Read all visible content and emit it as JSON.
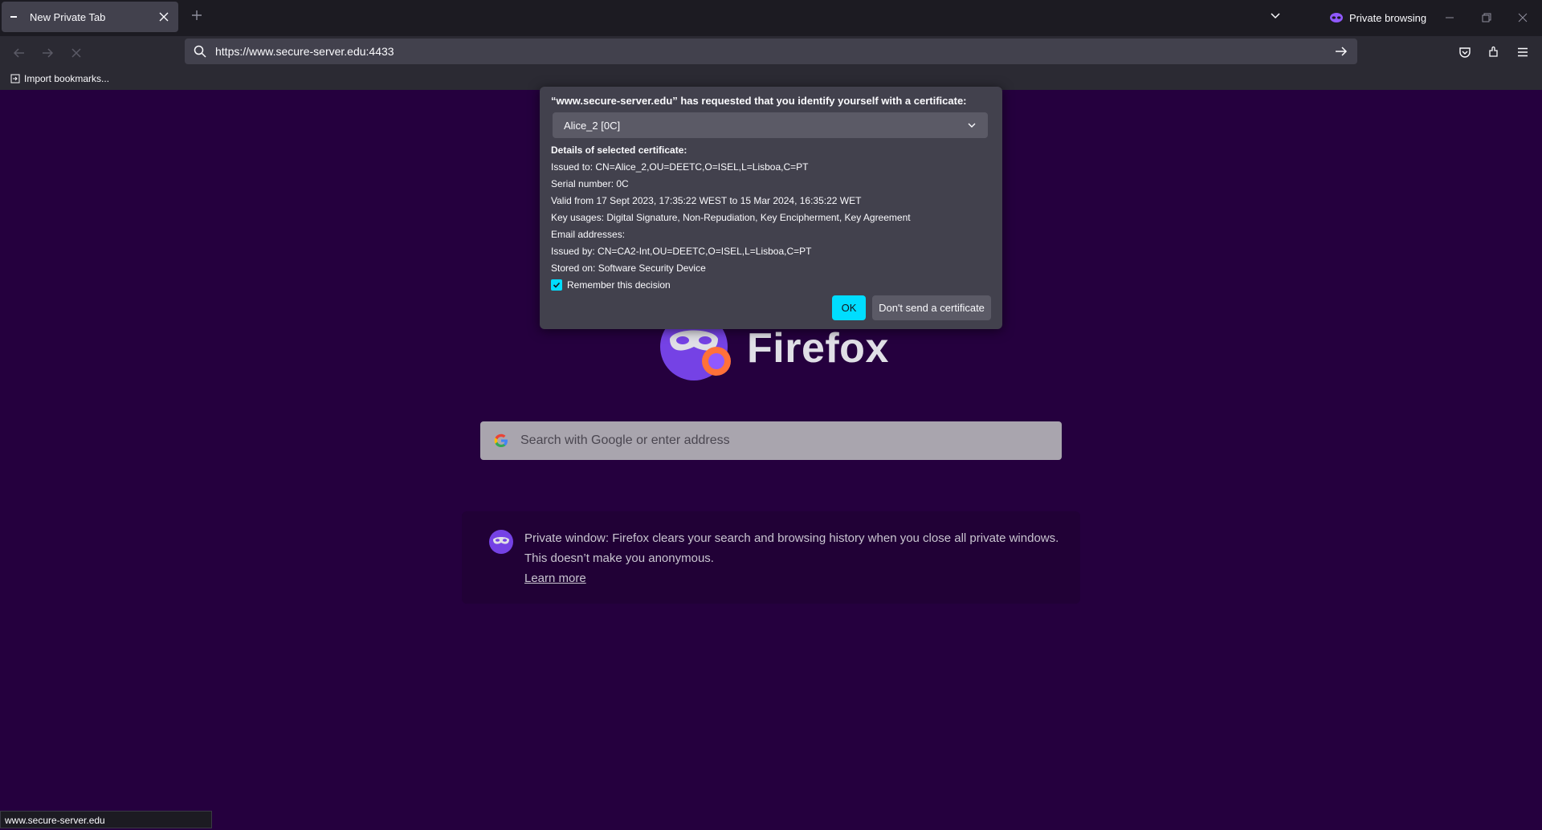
{
  "tab": {
    "title": "New Private Tab"
  },
  "window": {
    "private_label": "Private browsing"
  },
  "urlbar": {
    "url": "https://www.secure-server.edu:4433"
  },
  "bookmarks": {
    "import_label": "Import bookmarks..."
  },
  "brand": {
    "name": "Firefox"
  },
  "search": {
    "placeholder": "Search with Google or enter address"
  },
  "private_info": {
    "text": "Private window: Firefox clears your search and browsing history when you close all private windows. This doesn’t make you anonymous.",
    "link": "Learn more"
  },
  "status_bar": {
    "text": "www.secure-server.edu"
  },
  "dialog": {
    "header": "“www.secure-server.edu” has requested that you identify yourself with a certificate:",
    "selected_certificate": "Alice_2 [0C]",
    "details_title": "Details of selected certificate:",
    "details": [
      "Issued to: CN=Alice_2,OU=DEETC,O=ISEL,L=Lisboa,C=PT",
      "Serial number: 0C",
      "Valid from 17 Sept 2023, 17:35:22 WEST to 15 Mar 2024, 16:35:22 WET",
      "Key usages: Digital Signature, Non-Repudiation, Key Encipherment, Key Agreement",
      "Email addresses:",
      "Issued by: CN=CA2-Int,OU=DEETC,O=ISEL,L=Lisboa,C=PT",
      "Stored on: Software Security Device"
    ],
    "remember_label": "Remember this decision",
    "remember_checked": true,
    "ok_label": "OK",
    "dont_send_label": "Don't send a certificate"
  },
  "colors": {
    "accent": "#00ddff",
    "page_background": "#25003e",
    "dialog_background": "#42414d",
    "private_purple": "#7542e5"
  }
}
